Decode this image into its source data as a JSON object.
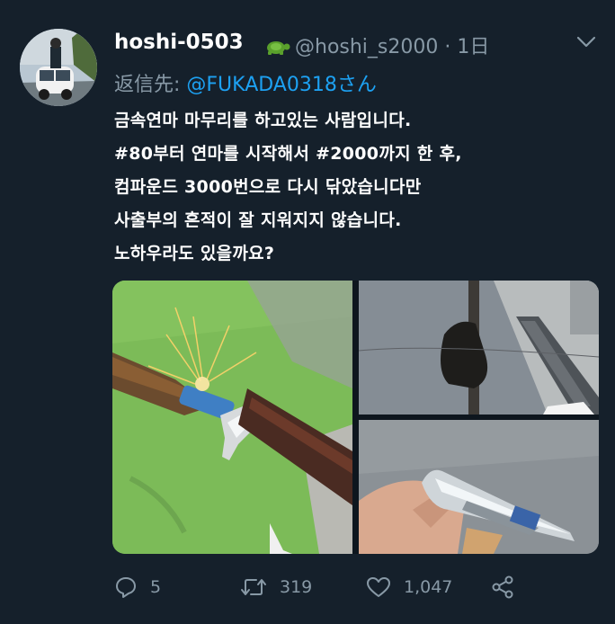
{
  "tweet": {
    "display_name": "hoshi-0503",
    "handle_and_time": "@hoshi_s2000 · 1日",
    "reply_prefix": "返信先: ",
    "reply_mention": "@FUKADA0318さん",
    "lines": [
      "금속연마 마무리를 하고있는 사람입니다.",
      "#80부터 연마를 시작해서 #2000까지 한 후,",
      "컴파운드 3000번으로 다시 닦았습니다만",
      "사출부의 흔적이 잘 지워지지 않습니다.",
      "노하우라도 있을까요?"
    ],
    "icons": {
      "name_badge": "turtle-icon",
      "menu": "chevron-down-icon",
      "reply": "reply-icon",
      "retweet": "retweet-icon",
      "like": "heart-icon",
      "share": "share-icon"
    },
    "colors": {
      "background": "#15202b",
      "muted": "#8899a6",
      "link": "#1da1f2",
      "text": "#ffffff"
    }
  },
  "actions": {
    "reply_count": "5",
    "retweet_count": "319",
    "like_count": "1,047"
  }
}
